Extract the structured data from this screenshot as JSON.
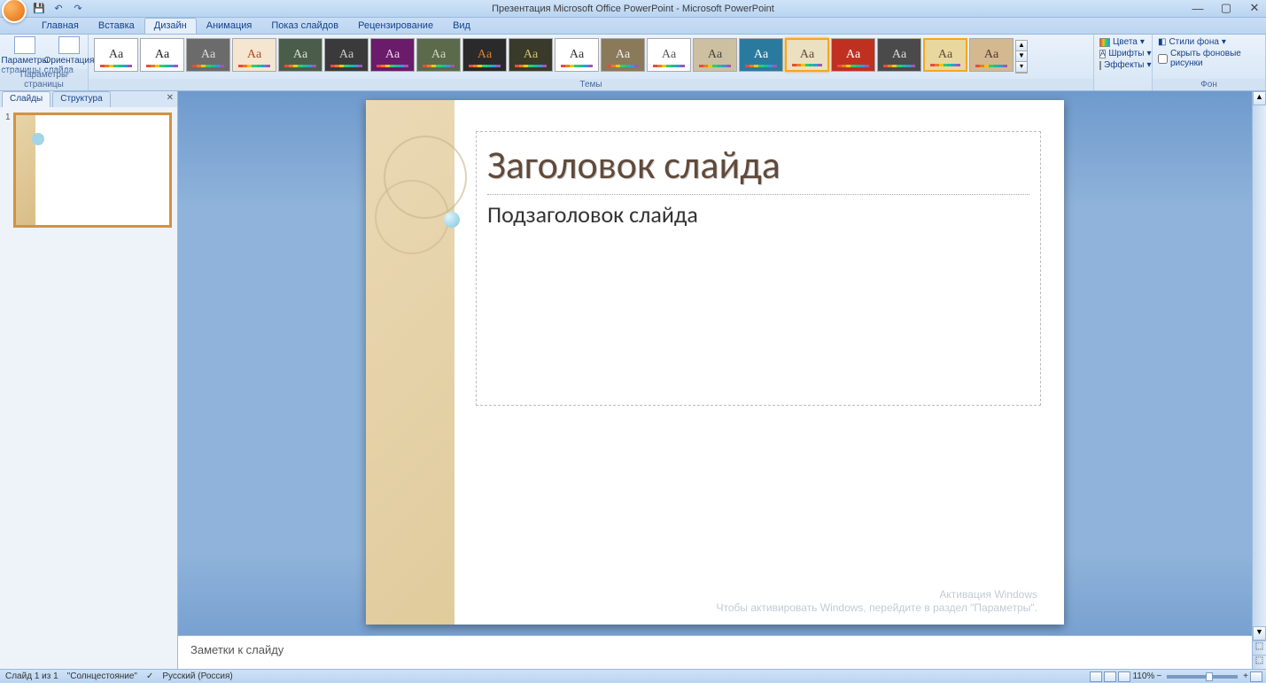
{
  "title": "Презентация Microsoft Office PowerPoint - Microsoft PowerPoint",
  "qat": {
    "save": "💾",
    "undo": "↶",
    "redo": "↷"
  },
  "tabs": {
    "home": "Главная",
    "insert": "Вставка",
    "design": "Дизайн",
    "animation": "Анимация",
    "slideshow": "Показ слайдов",
    "review": "Рецензирование",
    "view": "Вид"
  },
  "ribbon": {
    "page_params": {
      "page_setup": "Параметры страницы",
      "orientation": "Ориентация слайда",
      "group": "Параметры страницы"
    },
    "themes": {
      "group": "Темы"
    },
    "variants": {
      "colors": "Цвета",
      "fonts": "Шрифты",
      "effects": "Эффекты"
    },
    "background": {
      "styles": "Стили фона",
      "hide": "Скрыть фоновые рисунки",
      "group": "Фон"
    }
  },
  "panel": {
    "slides_tab": "Слайды",
    "outline_tab": "Структура",
    "thumb_num": "1"
  },
  "slide": {
    "title": "Заголовок слайда",
    "subtitle": "Подзаголовок слайда"
  },
  "notes": {
    "placeholder": "Заметки к слайду"
  },
  "watermark": {
    "line1": "Активация Windows",
    "line2": "Чтобы активировать Windows, перейдите в раздел \"Параметры\"."
  },
  "status": {
    "slide": "Слайд 1 из 1",
    "theme": "\"Солнцестояние\"",
    "lang": "Русский (Россия)",
    "zoom": "110%"
  },
  "theme_samples": [
    {
      "bg": "#ffffff",
      "fg": "#333333"
    },
    {
      "bg": "#ffffff",
      "fg": "#222222"
    },
    {
      "bg": "#6b6b6b",
      "fg": "#dddddd"
    },
    {
      "bg": "#f4e6d0",
      "fg": "#b54a1a"
    },
    {
      "bg": "#4a5d4a",
      "fg": "#d8e4d0"
    },
    {
      "bg": "#3a3a3a",
      "fg": "#cccccc"
    },
    {
      "bg": "#6a1b6a",
      "fg": "#f0d0f0"
    },
    {
      "bg": "#5a6a4a",
      "fg": "#d0dac0"
    },
    {
      "bg": "#2a2a2a",
      "fg": "#e08030"
    },
    {
      "bg": "#3a3a2a",
      "fg": "#d4c070"
    },
    {
      "bg": "#ffffff",
      "fg": "#333333"
    },
    {
      "bg": "#8a7a5a",
      "fg": "#eeeeee"
    },
    {
      "bg": "#ffffff",
      "fg": "#555555"
    },
    {
      "bg": "#ccc0a0",
      "fg": "#444444"
    },
    {
      "bg": "#2a7aa0",
      "fg": "#ffffff"
    },
    {
      "bg": "#ebe0c0",
      "fg": "#604a3a"
    },
    {
      "bg": "#c03020",
      "fg": "#ffffff"
    },
    {
      "bg": "#4a4a4a",
      "fg": "#dddddd"
    },
    {
      "bg": "#e8d8a0",
      "fg": "#604a3a"
    },
    {
      "bg": "#d4b890",
      "fg": "#503a2a"
    }
  ]
}
